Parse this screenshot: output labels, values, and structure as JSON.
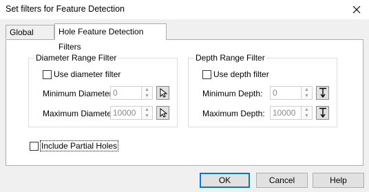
{
  "window": {
    "title": "Set filters for Feature Detection",
    "close_icon": "×"
  },
  "tabs": [
    {
      "label": "Global Filters"
    },
    {
      "label": "Hole Feature Detection Filters"
    }
  ],
  "diameter": {
    "title": "Diameter Range Filter",
    "use_label": "Use diameter filter",
    "min_label": "Minimum Diameter:",
    "min_value": "0",
    "max_label": "Maximum Diameter:",
    "max_value": "10000"
  },
  "depth": {
    "title": "Depth Range Filter",
    "use_label": "Use depth filter",
    "min_label": "Minimum Depth:",
    "min_value": "0",
    "max_label": "Maximum Depth:",
    "max_value": "10000"
  },
  "partial": {
    "label": "Include Partial Holes"
  },
  "buttons": {
    "ok": "OK",
    "cancel": "Cancel",
    "help": "Help"
  },
  "icons": {
    "spin_up": "▲",
    "spin_down": "▼"
  }
}
